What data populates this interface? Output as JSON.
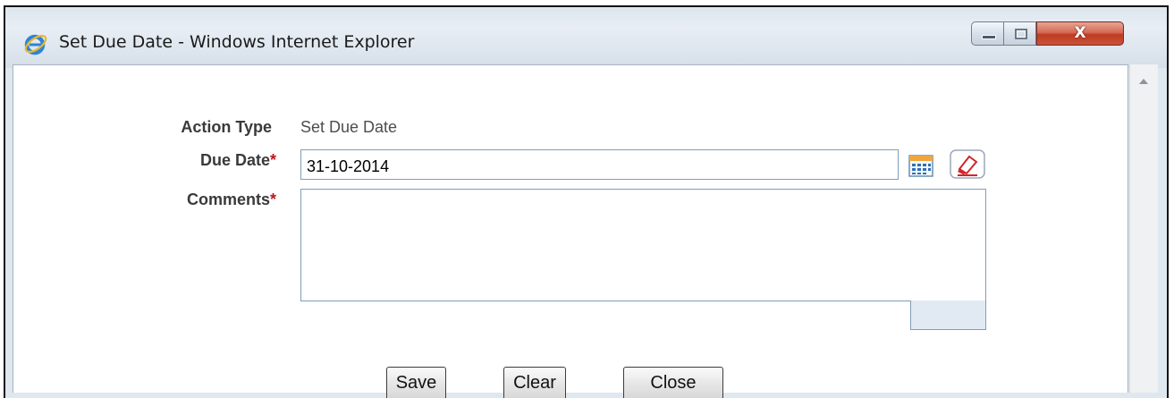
{
  "top_caption": "",
  "window": {
    "title": "Set Due Date - Windows Internet Explorer",
    "icon": "internet-explorer-icon",
    "controls": {
      "minimize_icon": "minimize-icon",
      "maximize_icon": "maximize-icon",
      "close_glyph": "X"
    }
  },
  "form": {
    "action_type": {
      "label": "Action Type",
      "value": "Set Due Date"
    },
    "due_date": {
      "label": "Due Date",
      "required_mark": "*",
      "value": "31-10-2014",
      "calendar_icon": "calendar-icon",
      "clear_icon": "eraser-icon"
    },
    "comments": {
      "label": "Comments",
      "required_mark": "*",
      "value": ""
    }
  },
  "buttons": {
    "save": "Save",
    "clear": "Clear",
    "close": "Close"
  },
  "colors": {
    "required_mark": "#c0141a",
    "close_button": "#bf3b22",
    "label_text": "#3a3a3a"
  }
}
